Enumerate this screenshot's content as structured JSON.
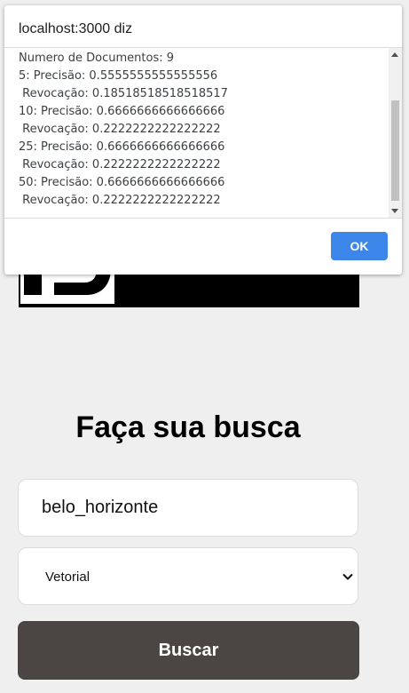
{
  "dialog": {
    "title": "localhost:3000 diz",
    "message": "Numero de Documentos: 9\n5: Precisão: 0.5555555555555556\n Revocação: 0.18518518518518517\n10: Precisão: 0.6666666666666666\n Revocação: 0.2222222222222222\n25: Precisão: 0.6666666666666666\n Revocação: 0.2222222222222222\n50: Precisão: 0.6666666666666666\n Revocação: 0.2222222222222222",
    "ok_label": "OK"
  },
  "main": {
    "title": "Faça sua busca",
    "search_value": "belo_horizonte",
    "model_select": {
      "selected": "Vetorial",
      "icon": "chevron-down-icon"
    },
    "search_button": "Buscar"
  },
  "colors": {
    "background": "#efefef",
    "button": "#4b4644",
    "dialog_ok": "#3b86e8",
    "logo": "#000000"
  }
}
